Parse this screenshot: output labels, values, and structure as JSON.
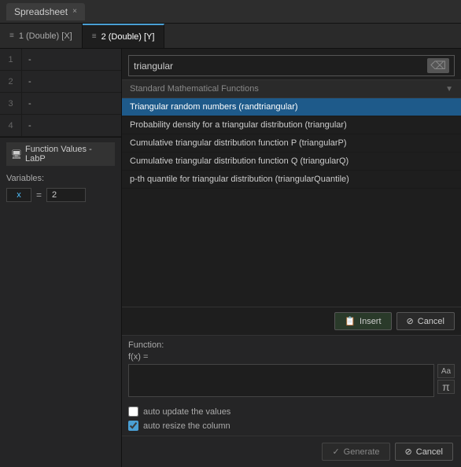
{
  "titleBar": {
    "tabLabel": "Spreadsheet",
    "closeBtn": "×"
  },
  "colTabs": [
    {
      "id": "col1",
      "label": "1 (Double) [X]",
      "active": false
    },
    {
      "id": "col2",
      "label": "2 (Double) [Y]",
      "active": true
    }
  ],
  "spreadsheet": {
    "rows": [
      {
        "num": "1",
        "val": "-"
      },
      {
        "num": "2",
        "val": "-"
      },
      {
        "num": "3",
        "val": "-"
      },
      {
        "num": "4",
        "val": "-"
      }
    ]
  },
  "subPanel": {
    "title": "Function Values - LabP",
    "variables": {
      "label": "Variables:",
      "items": [
        {
          "name": "x",
          "equals": "=",
          "value": "2"
        }
      ]
    }
  },
  "search": {
    "value": "triangular",
    "clearBtn": "⌫"
  },
  "category": {
    "label": "Standard Mathematical Functions",
    "chevron": "▼"
  },
  "functions": {
    "items": [
      {
        "label": "Triangular random numbers (randtriangular)",
        "selected": true
      },
      {
        "label": "Probability density for a triangular distribution (triangular)",
        "selected": false
      },
      {
        "label": "Cumulative triangular distribution function P (triangularP)",
        "selected": false
      },
      {
        "label": "Cumulative triangular distribution function Q (triangularQ)",
        "selected": false
      },
      {
        "label": "p-th quantile for triangular distribution (triangularQuantile)",
        "selected": false
      }
    ]
  },
  "actionButtons": {
    "insertIcon": "📋",
    "insertLabel": "Insert",
    "cancelIcon": "⊘",
    "cancelLabel": "Cancel"
  },
  "functionEditor": {
    "functionLabel": "Function:",
    "fxLabel": "f(x) =",
    "value": "",
    "sideButtons": {
      "aaLabel": "Aa",
      "piLabel": "π"
    }
  },
  "checkboxes": {
    "autoUpdate": {
      "label": "auto update the values",
      "checked": false
    },
    "autoResize": {
      "label": "auto resize the column",
      "checked": true
    }
  },
  "bottomButtons": {
    "generateIcon": "✓",
    "generateLabel": "Generate",
    "cancelIcon": "⊘",
    "cancelLabel": "Cancel"
  }
}
